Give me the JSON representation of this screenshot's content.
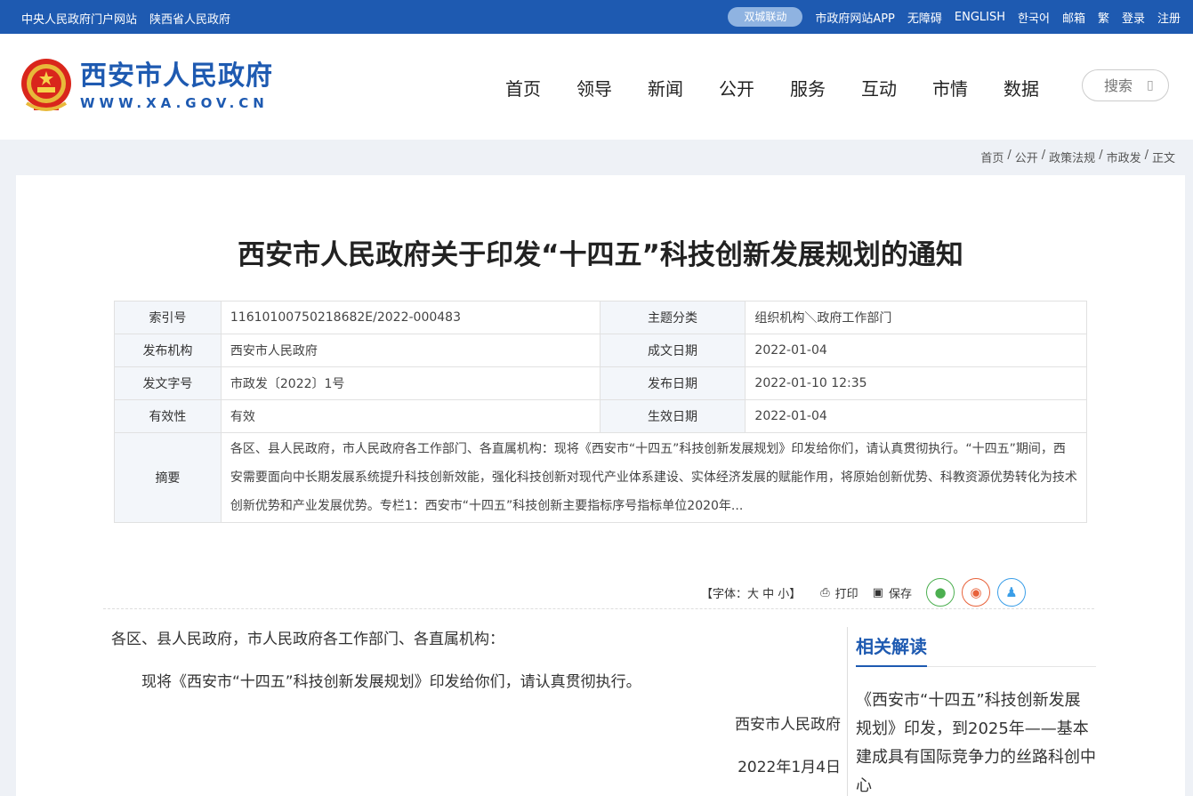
{
  "topbar": {
    "left_links": [
      "中央人民政府门户网站",
      "陕西省人民政府"
    ],
    "pill": "双城联动",
    "right_links": [
      "市政府网站APP",
      "无障碍",
      "ENGLISH",
      "한국어",
      "邮箱",
      "繁",
      "登录",
      "注册"
    ]
  },
  "header": {
    "site_title": "西安市人民政府",
    "site_url": "WWW.XA.GOV.CN",
    "nav": [
      "首页",
      "领导",
      "新闻",
      "公开",
      "服务",
      "互动",
      "市情",
      "数据"
    ],
    "search_placeholder": "搜索"
  },
  "breadcrumb": [
    "首页",
    "公开",
    "政策法规",
    "市政发",
    "正文"
  ],
  "article": {
    "title": "西安市人民政府关于印发“十四五”科技创新发展规划的通知",
    "meta": {
      "index_label": "索引号",
      "index_value": "11610100750218682E/2022-000483",
      "topic_label": "主题分类",
      "topic_value": "组织机构＼政府工作部门",
      "org_label": "发布机构",
      "org_value": "西安市人民政府",
      "created_label": "成文日期",
      "created_value": "2022-01-04",
      "doc_no_label": "发文字号",
      "doc_no_value": "市政发〔2022〕1号",
      "published_label": "发布日期",
      "published_value": "2022-01-10 12:35",
      "validity_label": "有效性",
      "validity_value": "有效",
      "effective_label": "生效日期",
      "effective_value": "2022-01-04",
      "abstract_label": "摘要",
      "abstract_value": "各区、县人民政府，市人民政府各工作部门、各直属机构：现将《西安市“十四五”科技创新发展规划》印发给你们，请认真贯彻执行。“十四五”期间，西安需要面向中长期发展系统提升科技创新效能，强化科技创新对现代产业体系建设、实体经济发展的赋能作用，将原始创新优势、科教资源优势转化为技术创新优势和产业发展优势。专栏1：西安市“十四五”科技创新主要指标序号指标单位2020年..."
    },
    "tools": {
      "font_size": "【字体：大 中 小】",
      "print": "打印",
      "save": "保存"
    },
    "body": {
      "salutation": "各区、县人民政府，市人民政府各工作部门、各直属机构：",
      "paragraph": "现将《西安市“十四五”科技创新发展规划》印发给你们，请认真贯彻执行。",
      "signature": "西安市人民政府",
      "date": "2022年1月4日"
    }
  },
  "related": {
    "heading": "相关解读",
    "items": [
      "《西安市“十四五”科技创新发展规划》印发，到2025年——基本建成具有国际竞争力的丝路科创中心"
    ]
  }
}
